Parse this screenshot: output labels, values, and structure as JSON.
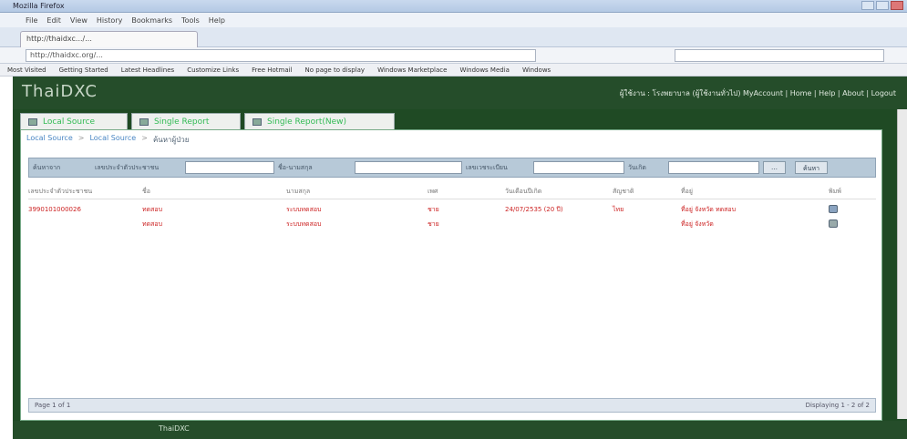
{
  "browser": {
    "window_title": "Mozilla Firefox",
    "menu": [
      "File",
      "Edit",
      "View",
      "History",
      "Bookmarks",
      "Tools",
      "Help"
    ],
    "tab_title": "http://thaidxc.../...",
    "url": "http://thaidxc.org/...",
    "bookmarks": [
      "Most Visited",
      "Getting Started",
      "Latest Headlines",
      "Customize Links",
      "Free Hotmail",
      "No page to display",
      "Windows Marketplace",
      "Windows Media",
      "Windows"
    ]
  },
  "header": {
    "logo": "ThaiDXC",
    "user_nav": "ผู้ใช้งาน : โรงพยาบาล (ผู้ใช้งานทั่วไป) MyAccount | Home | Help | About | Logout"
  },
  "tabs": [
    {
      "label": "Local Source"
    },
    {
      "label": "Single Report"
    },
    {
      "label": "Single Report(New)"
    }
  ],
  "breadcrumb": {
    "items": [
      "Local Source",
      "Local Source",
      "ค้นหาผู้ป่วย"
    ],
    "seps": [
      ">",
      ">"
    ]
  },
  "filter": {
    "label1": "ค้นหาจาก",
    "label2": "เลขประจำตัวประชาชน",
    "label3": "ชื่อ-นามสกุล",
    "label4": "เลขเวชระเบียน",
    "label5": "วันเกิด",
    "input_placeholder": "",
    "button": "ค้นหา"
  },
  "table": {
    "headers": [
      "เลขประจำตัวประชาชน",
      "ชื่อ",
      "นามสกุล",
      "เพศ",
      "วันเดือนปีเกิด",
      "สัญชาติ",
      "ที่อยู่",
      "พิมพ์"
    ],
    "rows": [
      [
        "3990101000026",
        "ทดสอบ",
        "ระบบทดสอบ",
        "ชาย",
        "24/07/2535 (20 ปี)",
        "ไทย",
        "ที่อยู่ จังหวัด ทดสอบ"
      ],
      [
        "",
        "ทดสอบ",
        "ระบบทดสอบ",
        "ชาย",
        "",
        "",
        "ที่อยู่ จังหวัด"
      ]
    ]
  },
  "pager": {
    "left": "Page 1 of 1",
    "right": "Displaying 1 - 2 of 2"
  },
  "footer": {
    "text": "ThaiDXC"
  }
}
